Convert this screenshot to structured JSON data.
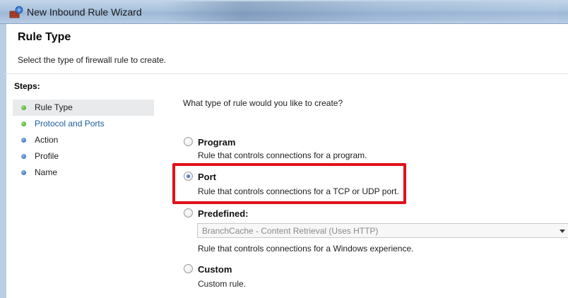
{
  "window": {
    "title": "New Inbound Rule Wizard",
    "icon": "firewall-wizard-icon"
  },
  "header": {
    "title": "Rule Type",
    "subtitle": "Select the type of firewall rule to create."
  },
  "steps": {
    "heading": "Steps:",
    "items": [
      {
        "label": "Rule Type",
        "state": "current",
        "dot": "#3a9a1e"
      },
      {
        "label": "Protocol and Ports",
        "state": "link",
        "dot": "#3a9a1e"
      },
      {
        "label": "Action",
        "state": "pending",
        "dot": "#2c5fb0"
      },
      {
        "label": "Profile",
        "state": "pending",
        "dot": "#2c5fb0"
      },
      {
        "label": "Name",
        "state": "pending",
        "dot": "#2c5fb0"
      }
    ]
  },
  "main": {
    "question": "What type of rule would you like to create?",
    "options": [
      {
        "label": "Program",
        "description": "Rule that controls connections for a program.",
        "checked": false
      },
      {
        "label": "Port",
        "description": "Rule that controls connections for a TCP or UDP port.",
        "checked": true
      },
      {
        "label": "Predefined:",
        "description": "Rule that controls connections for a Windows experience.",
        "checked": false
      },
      {
        "label": "Custom",
        "description": "Custom rule.",
        "checked": false
      }
    ],
    "predefined_select": {
      "value": "BranchCache - Content Retrieval (Uses HTTP)",
      "enabled": false
    }
  },
  "colors": {
    "highlight": "#e2101a",
    "link": "#1a5b9e",
    "titlebar": "#aac3de"
  }
}
